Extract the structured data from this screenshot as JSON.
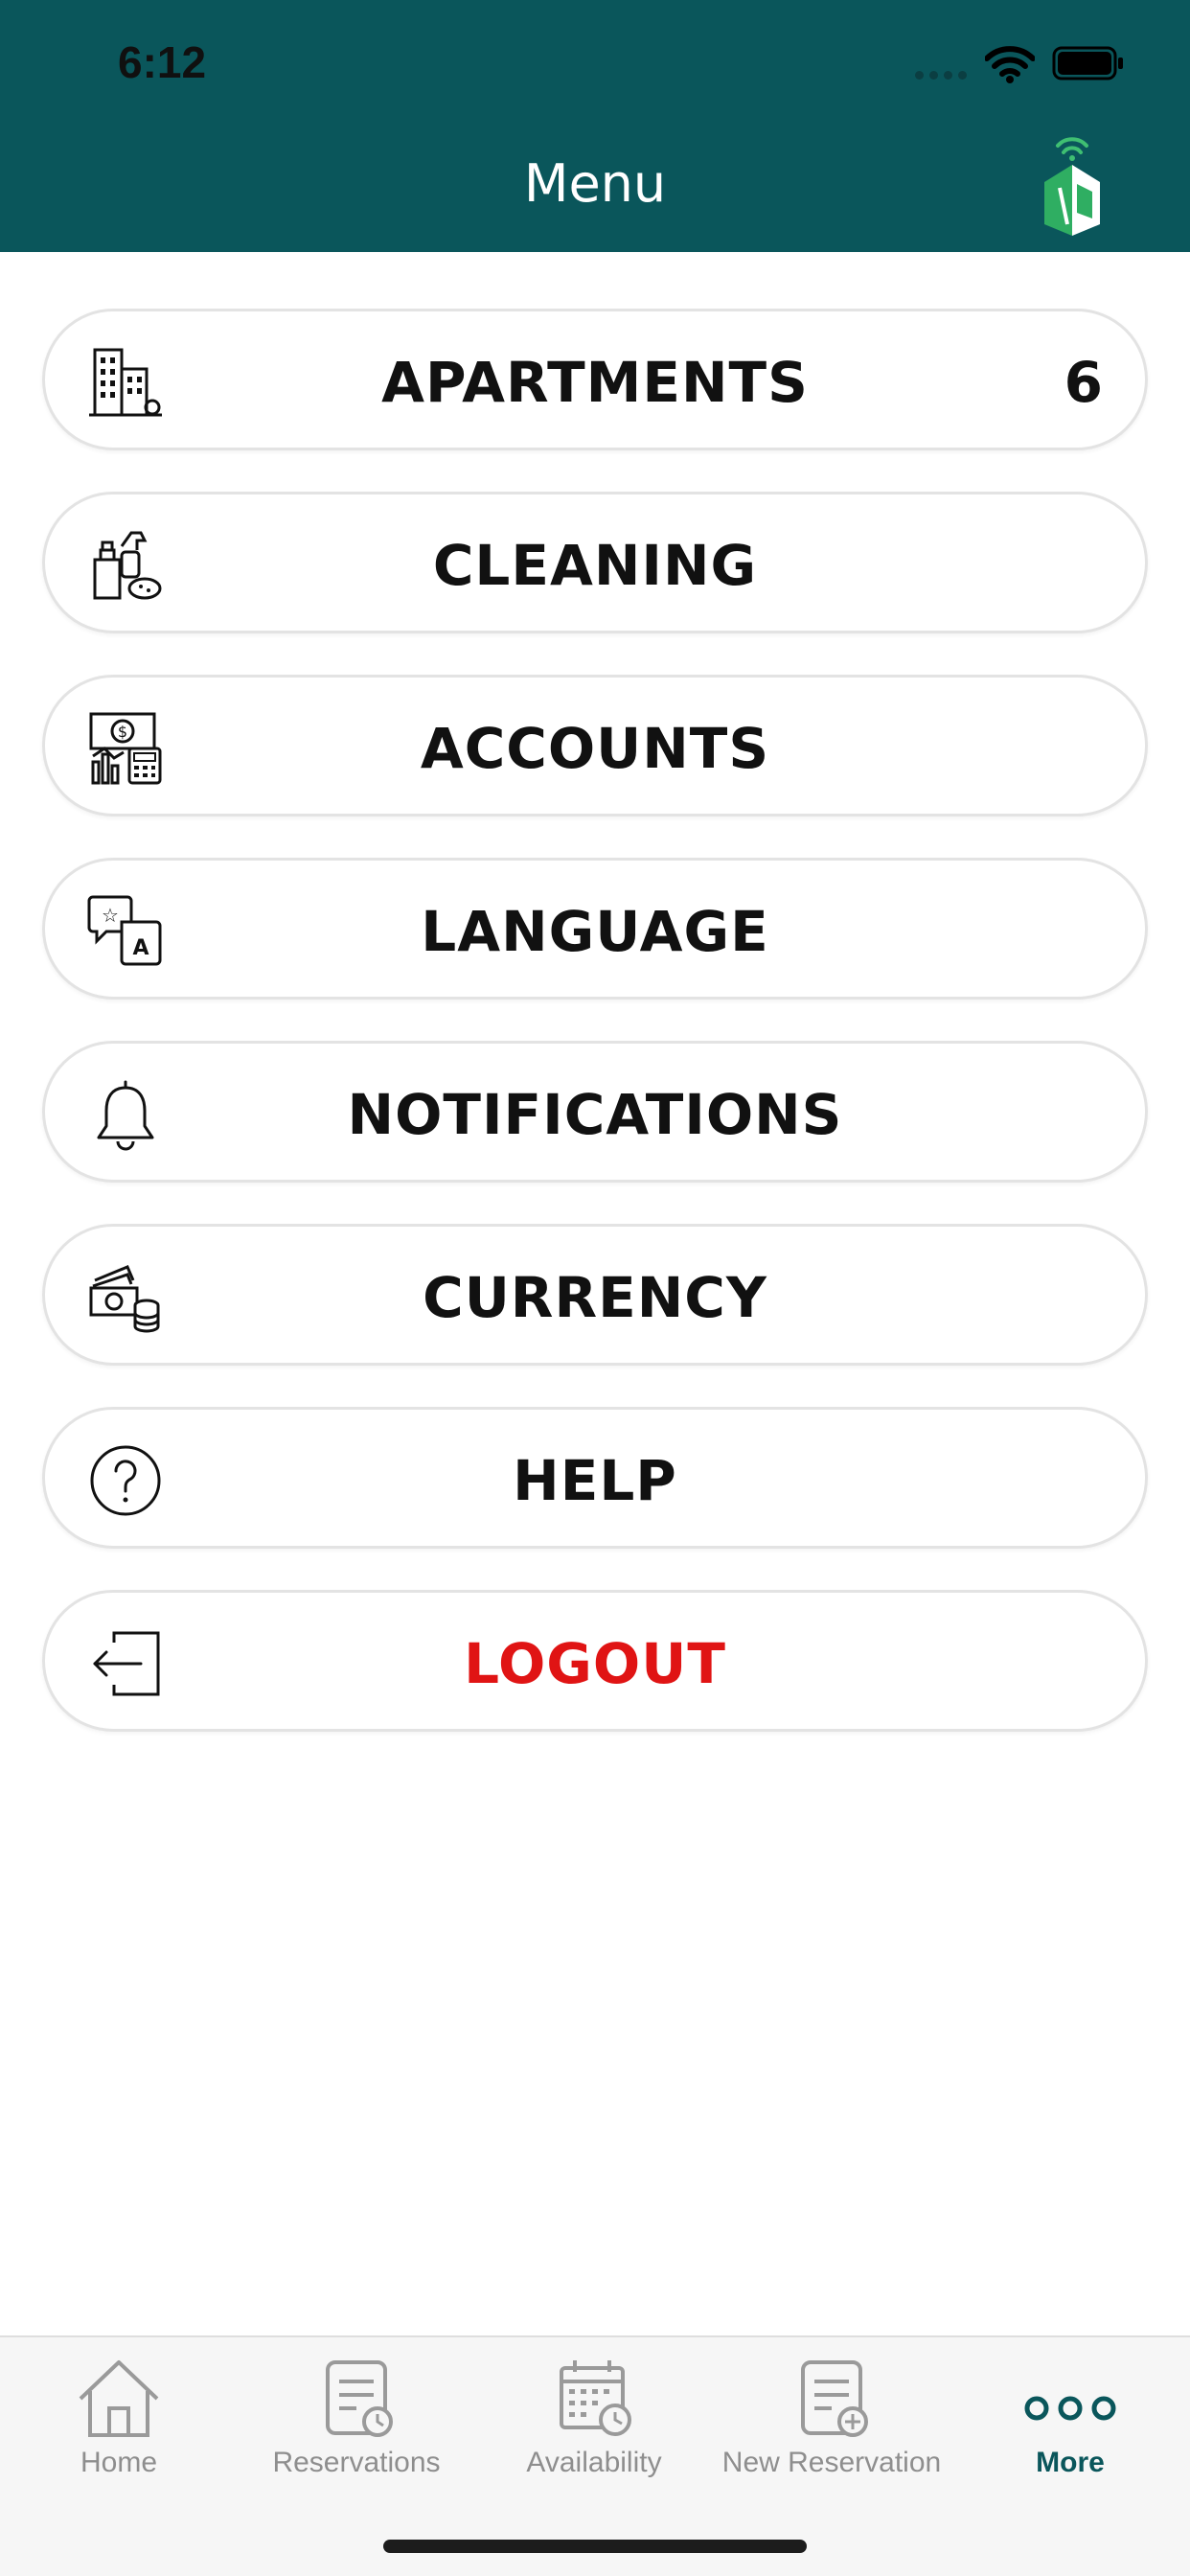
{
  "status_bar": {
    "time": "6:12"
  },
  "header": {
    "title": "Menu",
    "logo": "app-logo"
  },
  "menu": {
    "items": [
      {
        "label": "APARTMENTS",
        "count": "6",
        "icon": "buildings-icon"
      },
      {
        "label": "CLEANING",
        "icon": "cleaning-supplies-icon"
      },
      {
        "label": "ACCOUNTS",
        "icon": "money-calculator-icon"
      },
      {
        "label": "LANGUAGE",
        "icon": "translate-icon"
      },
      {
        "label": "NOTIFICATIONS",
        "icon": "bell-icon"
      },
      {
        "label": "CURRENCY",
        "icon": "cash-coins-icon"
      },
      {
        "label": "HELP",
        "icon": "question-icon"
      },
      {
        "label": "LOGOUT",
        "icon": "logout-icon"
      }
    ]
  },
  "tabbar": {
    "tabs": [
      {
        "label": "Home",
        "icon": "home-icon"
      },
      {
        "label": "Reservations",
        "icon": "reservations-icon"
      },
      {
        "label": "Availability",
        "icon": "calendar-clock-icon"
      },
      {
        "label": "New Reservation",
        "icon": "new-reservation-icon"
      },
      {
        "label": "More",
        "icon": "more-dots-icon"
      }
    ],
    "active": "More"
  },
  "colors": {
    "header_bg": "#0a565b",
    "logout": "#e01414",
    "active_tab": "#0a565b",
    "inactive_tab": "#8e8e8e"
  }
}
